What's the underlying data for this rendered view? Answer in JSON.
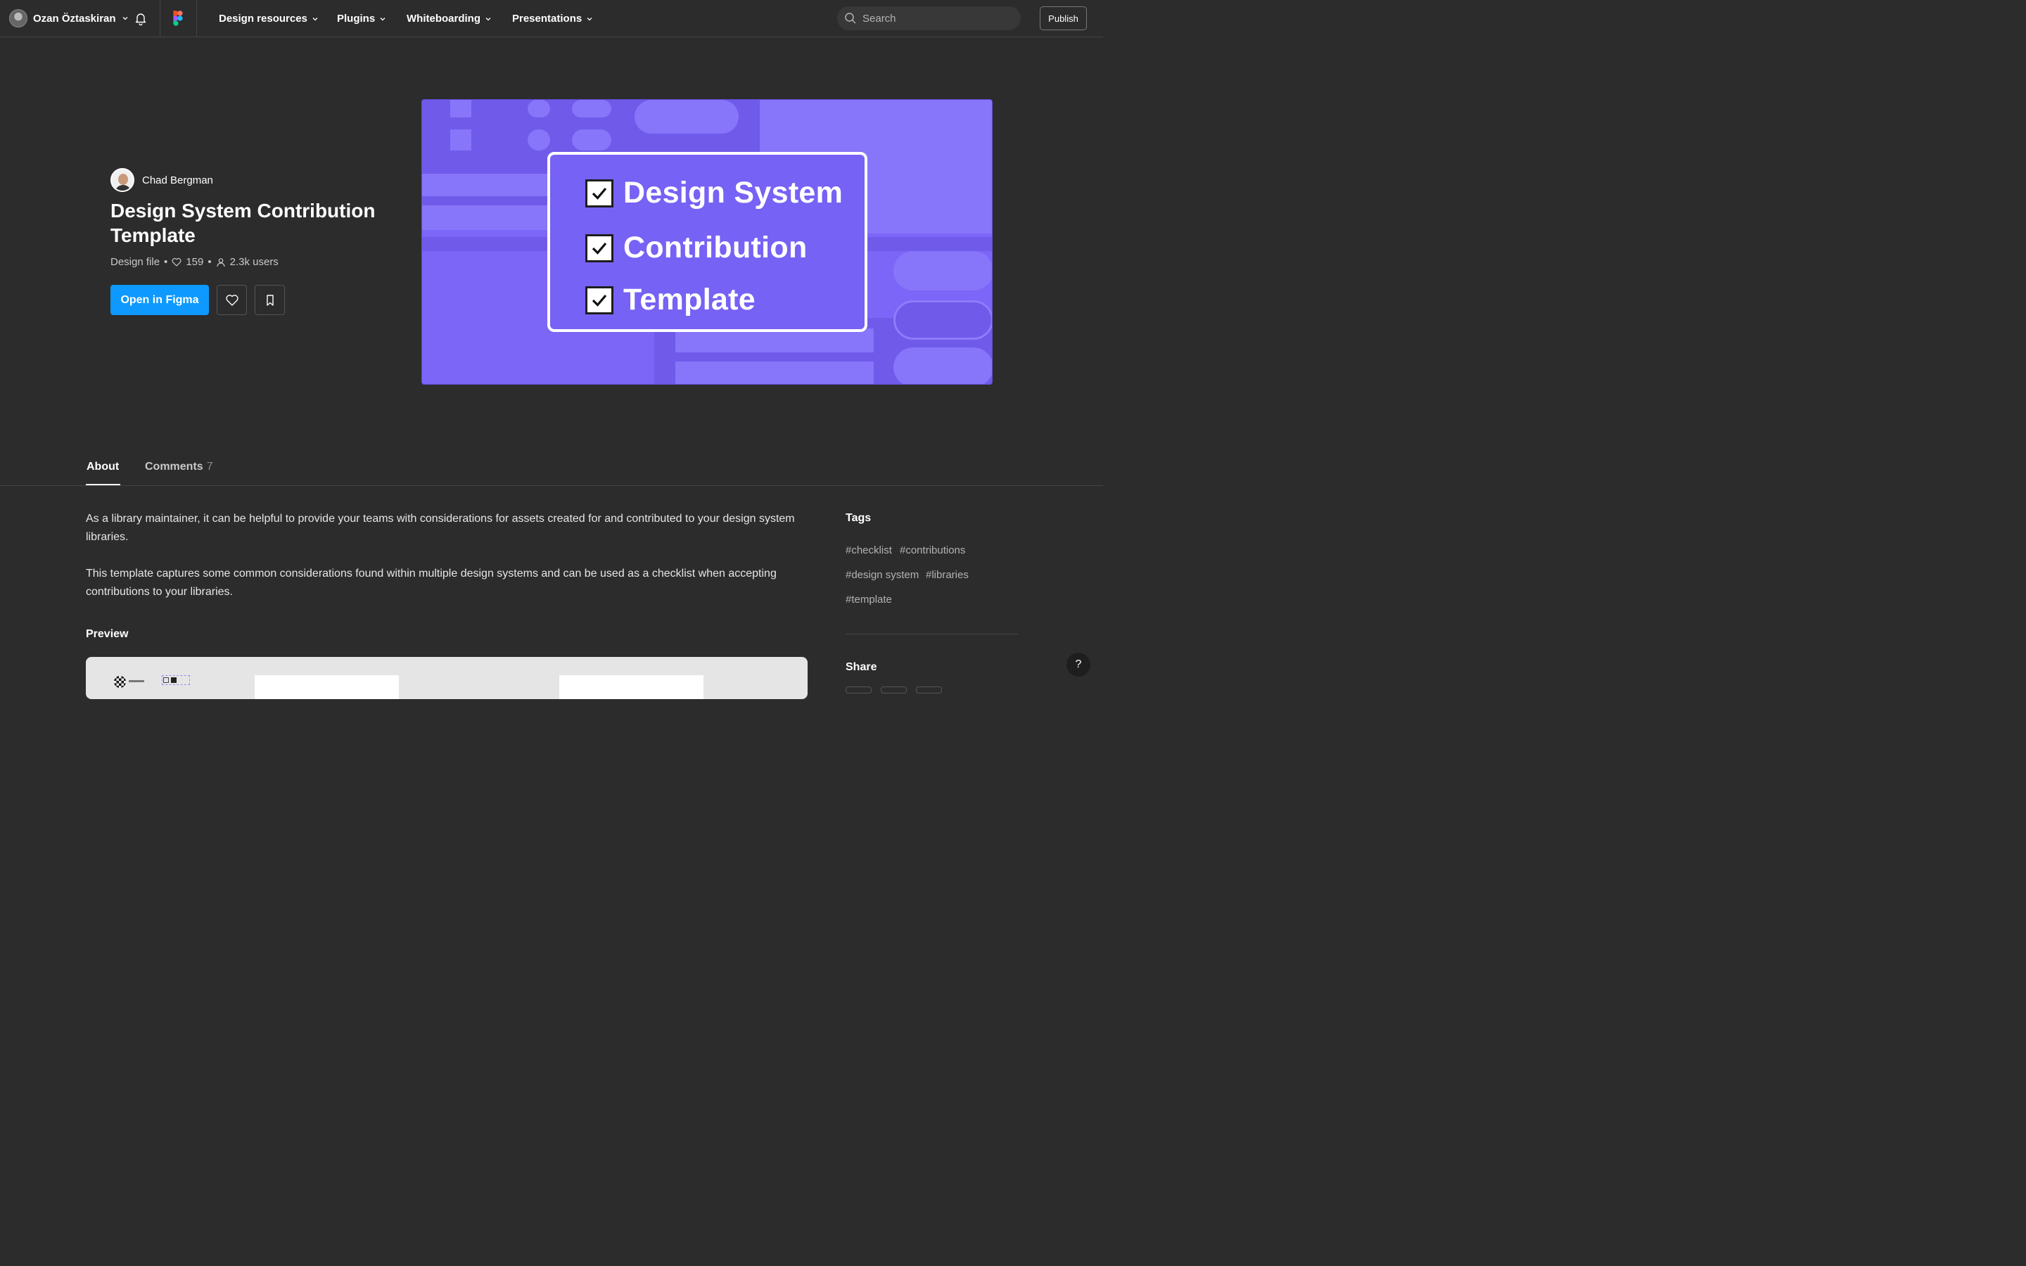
{
  "nav": {
    "user_name": "Ozan Öztaskiran",
    "menus": [
      "Design resources",
      "Plugins",
      "Whiteboarding",
      "Presentations"
    ],
    "search_placeholder": "Search",
    "publish_label": "Publish"
  },
  "resource": {
    "author": "Chad Bergman",
    "title": "Design System Contribution Template",
    "type": "Design file",
    "likes": "159",
    "users": "2.3k users",
    "open_label": "Open in Figma"
  },
  "cover": {
    "items": [
      "Design System",
      "Contribution",
      "Template"
    ],
    "background_color": "#7b66f8"
  },
  "tabs": {
    "about": "About",
    "comments": "Comments",
    "comments_count": "7"
  },
  "about": {
    "paragraph1": "As a library maintainer, it can be helpful to provide your teams with considerations for assets created for and contributed to your design system libraries.",
    "paragraph2": "This template captures some common considerations found within multiple design systems and can be used as a checklist when accepting contributions to your libraries.",
    "preview_label": "Preview"
  },
  "sidebar": {
    "tags_heading": "Tags",
    "tags": [
      "#checklist",
      "#contributions",
      "#design system",
      "#libraries",
      "#template"
    ],
    "share_heading": "Share"
  },
  "help_label": "?",
  "colors": {
    "background": "#2c2c2c",
    "accent": "#0d99ff"
  }
}
